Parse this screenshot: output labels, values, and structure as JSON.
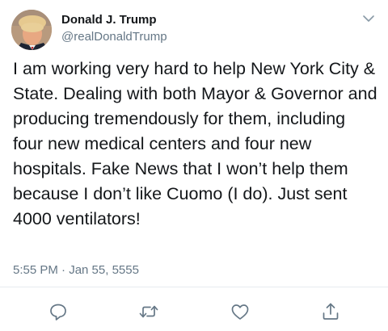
{
  "user": {
    "display_name": "Donald J. Trump",
    "handle": "@realDonaldTrump"
  },
  "tweet": {
    "text": "I am working very hard to help New York City & State. Dealing with both Mayor & Governor and producing tremendously for them, including four new medical centers and four new hospitals. Fake News that I won’t help them because I don’t like Cuomo (I do). Just sent 4000 ventilators!",
    "timestamp": "5:55 PM · Jan 55, 5555"
  },
  "icons": {
    "menu": "chevron-down-icon",
    "reply": "reply-icon",
    "retweet": "retweet-icon",
    "like": "heart-icon",
    "share": "share-icon"
  },
  "colors": {
    "text": "#14171a",
    "secondary": "#657786",
    "icon": "#657786",
    "divider": "#e6ecf0"
  }
}
